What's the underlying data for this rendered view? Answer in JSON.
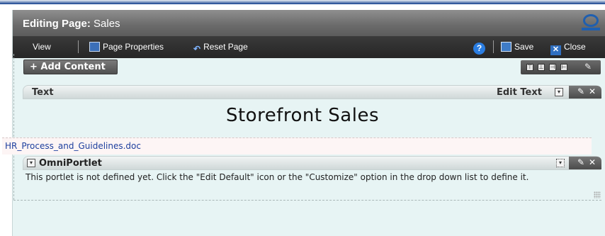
{
  "window": {
    "title_label": "Editing Page:",
    "title_page": "Sales",
    "logo": "oracle-logo-icon"
  },
  "toolbar": {
    "view": "View",
    "page_properties": "Page Properties",
    "reset_page": "Reset Page",
    "help_icon": "help-icon",
    "save": "Save",
    "close": "Close"
  },
  "content": {
    "add_content": "+ Add Content",
    "text_portlet": {
      "header": "Text",
      "edit_text": "Edit Text",
      "body_title": "Storefront  Sales"
    },
    "document_link": "HR_Process_and_Guidelines.doc",
    "omni_portlet": {
      "header": "OmniPortlet",
      "message": "This portlet is not defined yet. Click the \"Edit Default\" icon or the \"Customize\" option in the drop down list to define it."
    }
  },
  "colors": {
    "panel_bg": "#e7f4f4",
    "titlebar": "#6a6a6a",
    "toolbar": "#262626",
    "link": "#1d3f9e",
    "accent_blue": "#1f5fb0"
  }
}
